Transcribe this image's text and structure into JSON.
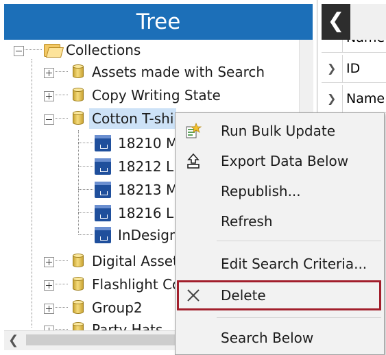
{
  "tree": {
    "title": "Tree",
    "root": {
      "label": "Collections"
    },
    "items": [
      {
        "label": "Assets made with Search"
      },
      {
        "label": "Copy Writing State"
      },
      {
        "label": "Cotton T-shi"
      },
      {
        "label": "Digital Asset"
      },
      {
        "label": "Flashlight Co"
      },
      {
        "label": "Group2"
      },
      {
        "label": "Party Hats"
      }
    ],
    "children": [
      {
        "label": "18210 M"
      },
      {
        "label": "18212 L"
      },
      {
        "label": "18213 M"
      },
      {
        "label": "18216 L"
      },
      {
        "label": "InDesign"
      }
    ]
  },
  "right_panel": {
    "partial_label": "Name",
    "rows": [
      {
        "label": "ID"
      },
      {
        "label": "Name"
      }
    ]
  },
  "context_menu": {
    "items": [
      {
        "label": "Run Bulk Update",
        "icon": "bulk-update-icon"
      },
      {
        "label": "Export Data Below",
        "icon": "export-icon"
      },
      {
        "label": "Republish..."
      },
      {
        "label": "Refresh"
      },
      {
        "label": "Edit Search Criteria..."
      },
      {
        "label": "Delete",
        "icon": "delete-icon",
        "highlight_color": "#a21f2c"
      },
      {
        "label": "Search Below"
      }
    ]
  }
}
